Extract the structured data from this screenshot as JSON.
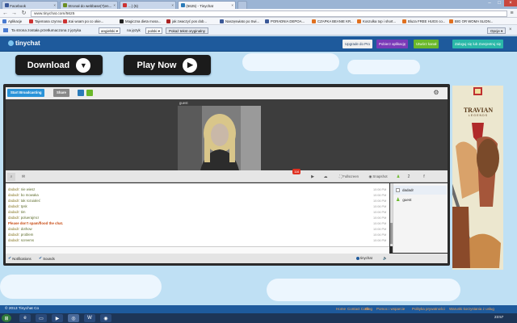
{
  "browser": {
    "tabs": [
      {
        "label": "Facebook",
        "favicon_color": "#3b5998",
        "active": false
      },
      {
        "label": "Stronał do webbase(?)en...",
        "favicon_color": "#6b8e23",
        "active": false
      },
      {
        "label": "…)  (5)",
        "favicon_color": "#cc3333",
        "active": false
      },
      {
        "label": "(5625) - Tinychat",
        "favicon_color": "#2a7ab8",
        "active": true
      }
    ],
    "url": "www.tinychat.com/5625",
    "bookmarks": [
      {
        "label": "Aplikacje",
        "color": "#4a7bd0"
      },
      {
        "label": "Tajemana czynno ś c...",
        "color": "#cc3333"
      },
      {
        "label": "Kai woam po co okie...",
        "color": "#cc3333"
      },
      {
        "label": "Magiczna dieta mosa...",
        "color": "#222222"
      },
      {
        "label": "jak zwaczyć pos dob...",
        "color": "#aa2222"
      },
      {
        "label": "Naszęswiato po Swi...",
        "color": "#3b5998"
      },
      {
        "label": "PORADNIA DEPOA...",
        "color": "#3b5998"
      },
      {
        "label": "CZAPKA BEANIE KR...",
        "color": "#e07020"
      },
      {
        "label": "Koszulka top i short...",
        "color": "#e07020"
      },
      {
        "label": "Bluza FREE HUGS co...",
        "color": "#e07020"
      },
      {
        "label": "BIG OR WOMA SLIDN...",
        "color": "#e07020"
      }
    ],
    "translate": {
      "message": "Ta strona została przetłumaczona z języka",
      "from_lang": "angielski",
      "to_label": "na język",
      "to_lang": "polski",
      "show_original": "Pokaż tekst oryginalny",
      "options": "Opcje"
    }
  },
  "header": {
    "logo": "tinychat",
    "buttons": [
      {
        "label": "Upgrade do Pro",
        "color": "#f0f0f0",
        "text": "#1e3a5f"
      },
      {
        "label": "Pobierz aplikację",
        "color": "#7a3ab8",
        "text": "#ffffff"
      },
      {
        "label": "Utwórz kanał",
        "color": "#6ab82a",
        "text": "#ffffff"
      },
      {
        "label": "Zaloguj się lub Zarejestruj się",
        "color": "#2ab8a8",
        "text": "#ffffff"
      }
    ]
  },
  "promo": {
    "download": "Download",
    "play": "Play Now"
  },
  "room": {
    "start_broadcasting": "Start Broadcasting",
    "share": "Share",
    "cam_label": "guest",
    "badge_count": "116",
    "fullscreen": "Fullscreen",
    "snapshot": "Snapshot",
    "user_count": "2",
    "messages": [
      {
        "nick": "dadadr:",
        "text": "nie wiesz",
        "time": "10:06 PM"
      },
      {
        "nick": "dadadr:",
        "text": "bo mowaka",
        "time": "10:06 PM"
      },
      {
        "nick": "dadadr:",
        "text": "tak rozuialeć",
        "time": "10:06 PM"
      },
      {
        "nick": "dadadr:",
        "text": "tpsk",
        "time": "10:06 PM"
      },
      {
        "nick": "dadadr:",
        "text": "tim",
        "time": "10:06 PM"
      },
      {
        "nick": "dadadr:",
        "text": "poluerajmcr",
        "time": "10:06 PM"
      },
      {
        "nick": "",
        "text": "Please don't spam/flood the chat.",
        "time": "10:06 PM",
        "warn": true
      },
      {
        "nick": "dadadr:",
        "text": "dothow",
        "time": "10:06 PM"
      },
      {
        "nick": "dadadr:",
        "text": "problem",
        "time": "10:06 PM"
      },
      {
        "nick": "dadadr:",
        "text": "screems",
        "time": "10:06 PM"
      }
    ],
    "users": [
      "dadadr",
      "guest"
    ],
    "notifications": "Notifications",
    "sounds": "Sounds",
    "tinychat_label": "tinychat"
  },
  "ad": {
    "title": "TRAVIAN",
    "sub": "LEGENDS"
  },
  "footer": {
    "copyright": "© 2013 Tinychat Co",
    "links": [
      "Home",
      "Contact Code",
      "Blog",
      "Pomoc i wsparcie",
      "Polityka prywatności",
      "Warunki korzystania z usług"
    ]
  },
  "taskbar": {
    "clock": "23:57",
    "apps": [
      "start",
      "ie",
      "folder",
      "media",
      "chrome",
      "word",
      "firefox"
    ]
  },
  "colors": {
    "accent": "#1e5a9c",
    "page_bg": "#bfe0f4",
    "start_btn": "#2a93d8",
    "share_btn": "#888888",
    "warn": "#c84a12",
    "badge": "#e03020"
  }
}
